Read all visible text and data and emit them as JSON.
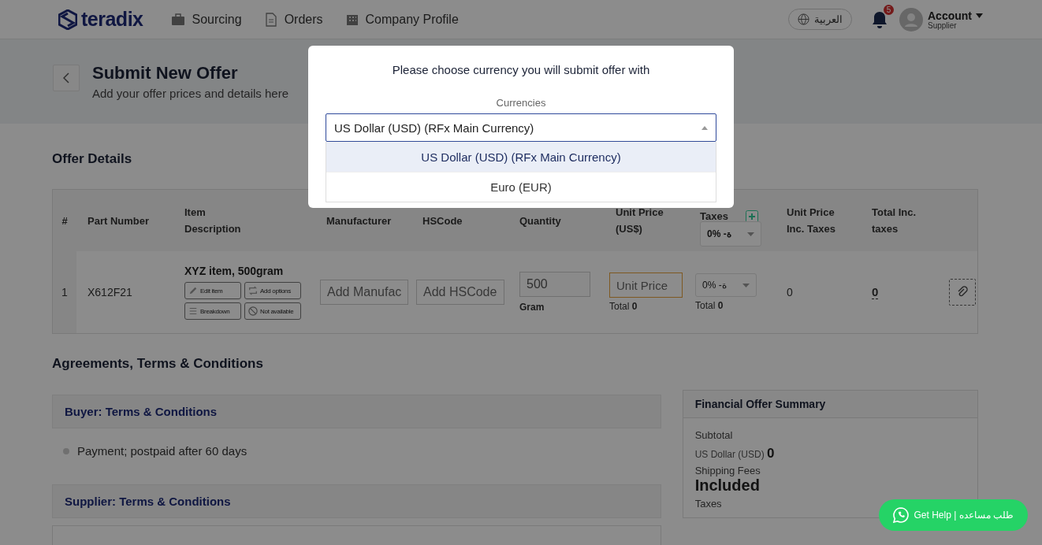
{
  "header": {
    "logo": "teradix",
    "nav": [
      {
        "label": "Sourcing"
      },
      {
        "label": "Orders"
      },
      {
        "label": "Company Profile"
      }
    ],
    "language": "العربية",
    "notifications": "5",
    "account": {
      "name": "Account",
      "role": "Supplier"
    }
  },
  "page": {
    "title": "Submit New Offer",
    "subtitle": "Add your offer prices and details here"
  },
  "offer_details": {
    "heading": "Offer Details",
    "table": {
      "columns": [
        "#",
        "Part Number",
        "Item Description",
        "Manufacturer",
        "HSCode",
        "Quantity",
        "Unit Price (US$)",
        "Taxes",
        "Unit Price Inc. Taxes",
        "Total Inc. taxes"
      ],
      "header_tax": "0% -ة",
      "rows": [
        {
          "number": "1",
          "part_number": "X612F21",
          "description": "XYZ item, 500gram",
          "actions": [
            "Edit item",
            "Add options",
            "Breakdown",
            "Not available"
          ],
          "manufacturer_placeholder": "Add Manufac",
          "hscode_placeholder": "Add HSCode",
          "quantity": "500",
          "unit": "Gram",
          "unit_price_placeholder": "Unit Price",
          "unit_price_total": "Total **0**",
          "tax": "0% -ة",
          "tax_total": "Total **0**",
          "unit_price_inc": "0",
          "total_inc": "0"
        }
      ]
    }
  },
  "agreements": {
    "heading": "Agreements, Terms & Conditions",
    "buyer_terms": {
      "heading": "Buyer: Terms & Conditions",
      "items": [
        "Payment; postpaid after 60 days"
      ]
    },
    "supplier_terms": {
      "heading": "Supplier: Terms & Conditions"
    }
  },
  "summary": {
    "heading": "Financial Offer Summary",
    "subtotal_label": "Subtotal",
    "subtotal_currency": "US Dollar (USD)",
    "subtotal_value": "0",
    "shipping_label": "Shipping Fees",
    "shipping_value": "Included",
    "taxes_label": "Taxes"
  },
  "help_button": "Get Help | طلب مساعده",
  "modal": {
    "title": "Please choose currency you will submit offer with",
    "field_label": "Currencies",
    "value": "US Dollar (USD) (RFx Main Currency)",
    "options": [
      {
        "label": "US Dollar (USD) (RFx Main Currency)",
        "selected": true
      },
      {
        "label": "Euro (EUR)",
        "selected": false
      }
    ]
  }
}
